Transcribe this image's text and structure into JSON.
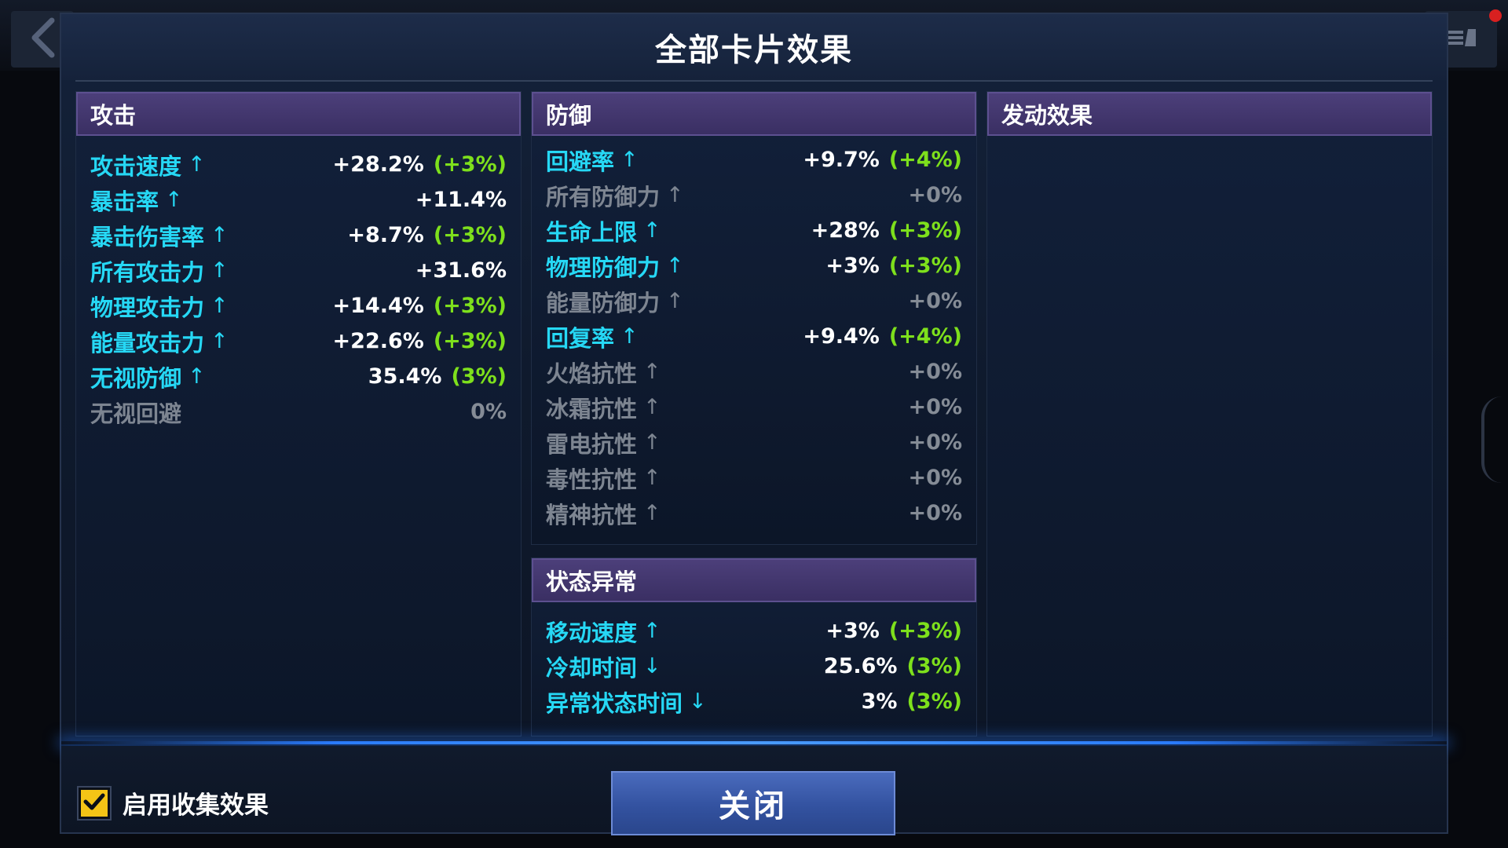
{
  "dialog": {
    "title": "全部卡片效果"
  },
  "panels": {
    "attack": {
      "title": "攻击",
      "stats": [
        {
          "label": "攻击速度",
          "arrow": "↑",
          "value": "+28.2%",
          "bonus": "(+3%)",
          "active": true
        },
        {
          "label": "暴击率",
          "arrow": "↑",
          "value": "+11.4%",
          "bonus": "",
          "active": true
        },
        {
          "label": "暴击伤害率",
          "arrow": "↑",
          "value": "+8.7%",
          "bonus": "(+3%)",
          "active": true
        },
        {
          "label": "所有攻击力",
          "arrow": "↑",
          "value": "+31.6%",
          "bonus": "",
          "active": true
        },
        {
          "label": "物理攻击力",
          "arrow": "↑",
          "value": "+14.4%",
          "bonus": "(+3%)",
          "active": true
        },
        {
          "label": "能量攻击力",
          "arrow": "↑",
          "value": "+22.6%",
          "bonus": "(+3%)",
          "active": true
        },
        {
          "label": "无视防御",
          "arrow": "↑",
          "value": "35.4%",
          "bonus": "(3%)",
          "active": true
        },
        {
          "label": "无视回避",
          "arrow": "",
          "value": "0%",
          "bonus": "",
          "active": false
        }
      ]
    },
    "defense": {
      "title": "防御",
      "stats": [
        {
          "label": "回避率",
          "arrow": "↑",
          "value": "+9.7%",
          "bonus": "(+4%)",
          "active": true
        },
        {
          "label": "所有防御力",
          "arrow": "↑",
          "value": "+0%",
          "bonus": "",
          "active": false
        },
        {
          "label": "生命上限",
          "arrow": "↑",
          "value": "+28%",
          "bonus": "(+3%)",
          "active": true
        },
        {
          "label": "物理防御力",
          "arrow": "↑",
          "value": "+3%",
          "bonus": "(+3%)",
          "active": true
        },
        {
          "label": "能量防御力",
          "arrow": "↑",
          "value": "+0%",
          "bonus": "",
          "active": false
        },
        {
          "label": "回复率",
          "arrow": "↑",
          "value": "+9.4%",
          "bonus": "(+4%)",
          "active": true
        },
        {
          "label": "火焰抗性",
          "arrow": "↑",
          "value": "+0%",
          "bonus": "",
          "active": false
        },
        {
          "label": "冰霜抗性",
          "arrow": "↑",
          "value": "+0%",
          "bonus": "",
          "active": false
        },
        {
          "label": "雷电抗性",
          "arrow": "↑",
          "value": "+0%",
          "bonus": "",
          "active": false
        },
        {
          "label": "毒性抗性",
          "arrow": "↑",
          "value": "+0%",
          "bonus": "",
          "active": false
        },
        {
          "label": "精神抗性",
          "arrow": "↑",
          "value": "+0%",
          "bonus": "",
          "active": false
        }
      ]
    },
    "status": {
      "title": "状态异常",
      "stats": [
        {
          "label": "移动速度",
          "arrow": "↑",
          "value": "+3%",
          "bonus": "(+3%)",
          "active": true
        },
        {
          "label": "冷却时间",
          "arrow": "↓",
          "value": "25.6%",
          "bonus": "(3%)",
          "active": true
        },
        {
          "label": "异常状态时间",
          "arrow": "↓",
          "value": "3%",
          "bonus": "(3%)",
          "active": true
        }
      ]
    },
    "trigger": {
      "title": "发动效果",
      "stats": []
    }
  },
  "footer": {
    "checkbox_label": "启用收集效果",
    "checkbox_checked": true,
    "close_label": "关闭"
  },
  "colors": {
    "active_label": "#26d8f5",
    "inactive_label": "#7d8591",
    "bonus": "#7ee01c",
    "checkbox": "#f4c416",
    "header": "#3a2f63",
    "notification": "#d82020"
  },
  "icons": [
    "back-arrow-icon",
    "menu-icon",
    "notification-dot",
    "checkmark-icon",
    "up-arrow-icon",
    "down-arrow-icon"
  ]
}
